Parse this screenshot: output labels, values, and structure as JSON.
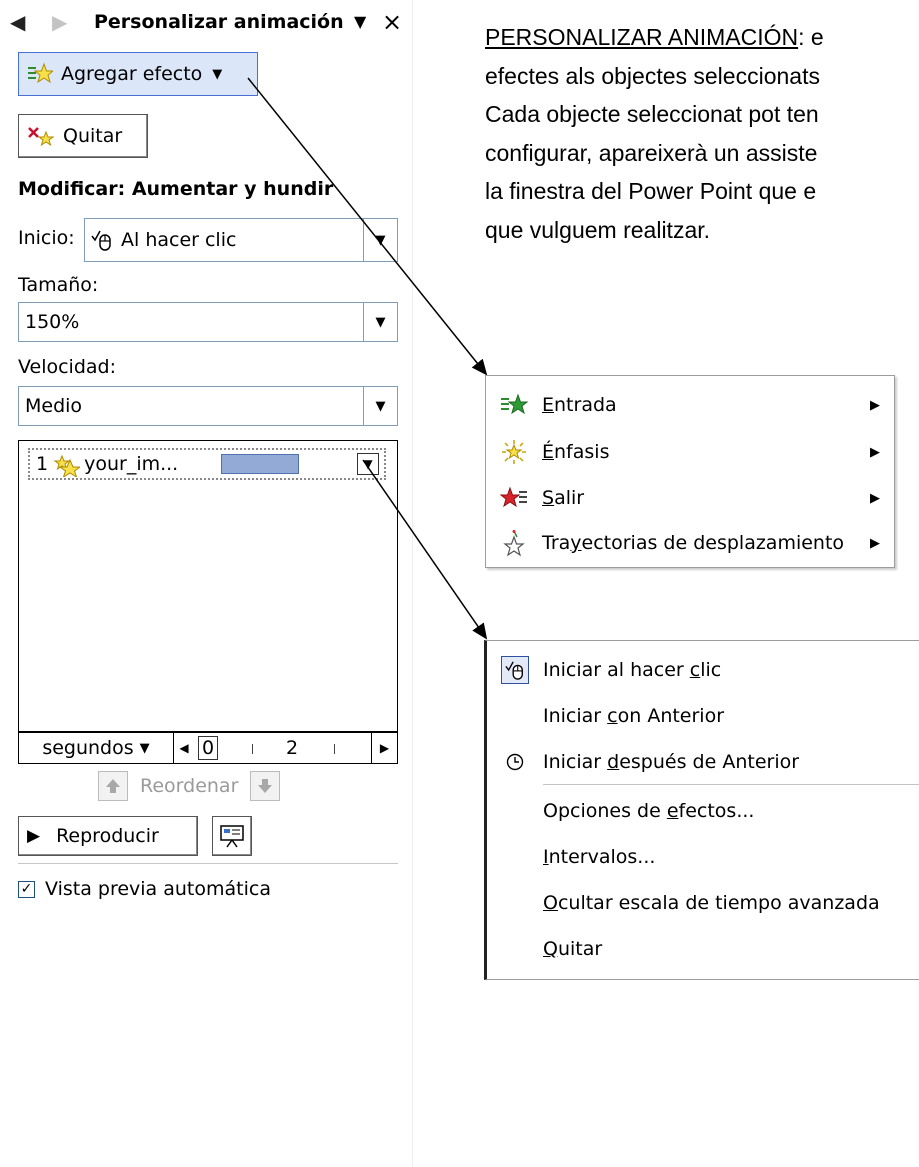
{
  "pane": {
    "title": "Personalizar animación",
    "add_effect_label": "Agregar efecto",
    "remove_label": "Quitar",
    "modify_label": "Modificar: Aumentar y hundir",
    "start_label": "Inicio:",
    "start_value": "Al hacer clic",
    "size_label": "Tamaño:",
    "size_value": "150%",
    "speed_label": "Velocidad:",
    "speed_value": "Medio",
    "list_item": {
      "number": "1",
      "name": "your_im..."
    },
    "timeline": {
      "unit": "segundos",
      "value_zero": "0",
      "value_two": "2"
    },
    "reorder_label": "Reordenar",
    "play_label": "Reproducir",
    "autopreview_label": "Vista previa automática",
    "autopreview_checked": true
  },
  "explanation": {
    "heading": "PERSONALIZAR ANIMACIÓN",
    "line1_rest": ": e",
    "line2": "efectes als objectes seleccionats",
    "line3": "Cada objecte seleccionat pot ten",
    "line4": "configurar, apareixerà un assiste",
    "line5": "la finestra del Power Point que e",
    "line6": "que vulguem realitzar."
  },
  "effect_menu": {
    "items": [
      {
        "pre": "",
        "key": "E",
        "post": "ntrada",
        "has_submenu": true,
        "icon": "entrance-star-icon"
      },
      {
        "pre": "",
        "key": "É",
        "post": "nfasis",
        "has_submenu": true,
        "icon": "emphasis-star-icon"
      },
      {
        "pre": "",
        "key": "S",
        "post": "alir",
        "has_submenu": true,
        "icon": "exit-star-icon"
      },
      {
        "pre": "Tra",
        "key": "y",
        "post": "ectorias de desplazamiento",
        "has_submenu": true,
        "icon": "motion-path-star-icon"
      }
    ]
  },
  "context_menu": {
    "items": [
      {
        "pre": "Iniciar al hacer ",
        "key": "c",
        "post": "lic",
        "icon": "mouse-click-icon"
      },
      {
        "pre": "Iniciar ",
        "key": "c",
        "post": "on Anterior",
        "icon": ""
      },
      {
        "pre": "Iniciar ",
        "key": "d",
        "post": "espués de Anterior",
        "icon": "clock-icon"
      },
      {
        "pre": "Opciones de ",
        "key": "e",
        "post": "fectos...",
        "icon": ""
      },
      {
        "pre": "",
        "key": "I",
        "post": "ntervalos...",
        "icon": ""
      },
      {
        "pre": "",
        "key": "O",
        "post": "cultar escala de tiempo avanzada",
        "icon": ""
      },
      {
        "pre": "",
        "key": "Q",
        "post": "uitar",
        "icon": ""
      }
    ]
  },
  "colors": {
    "accent_border": "#4a6fd6",
    "button_highlight": "#dbe6f8",
    "bar_fill": "#93a9d6"
  }
}
